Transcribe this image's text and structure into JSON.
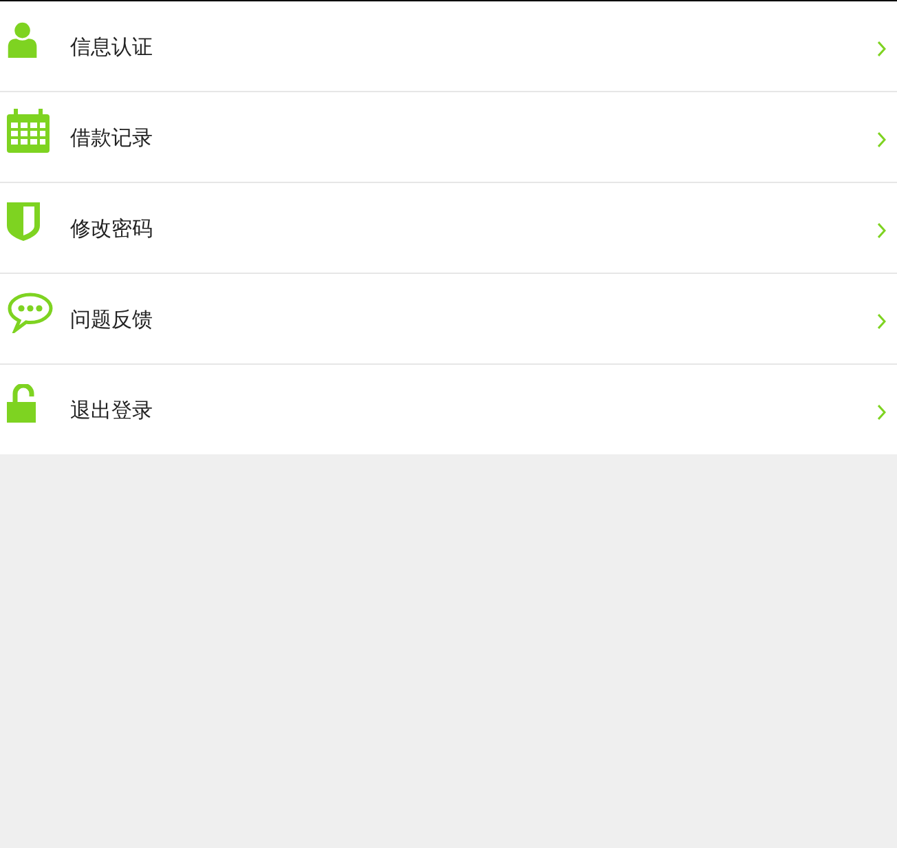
{
  "menu": [
    {
      "kind": "user",
      "label": "信息认证"
    },
    {
      "kind": "calendar",
      "label": "借款记录"
    },
    {
      "kind": "shield",
      "label": "修改密码"
    },
    {
      "kind": "chat",
      "label": "问题反馈"
    },
    {
      "kind": "lock",
      "label": "退出登录"
    }
  ]
}
